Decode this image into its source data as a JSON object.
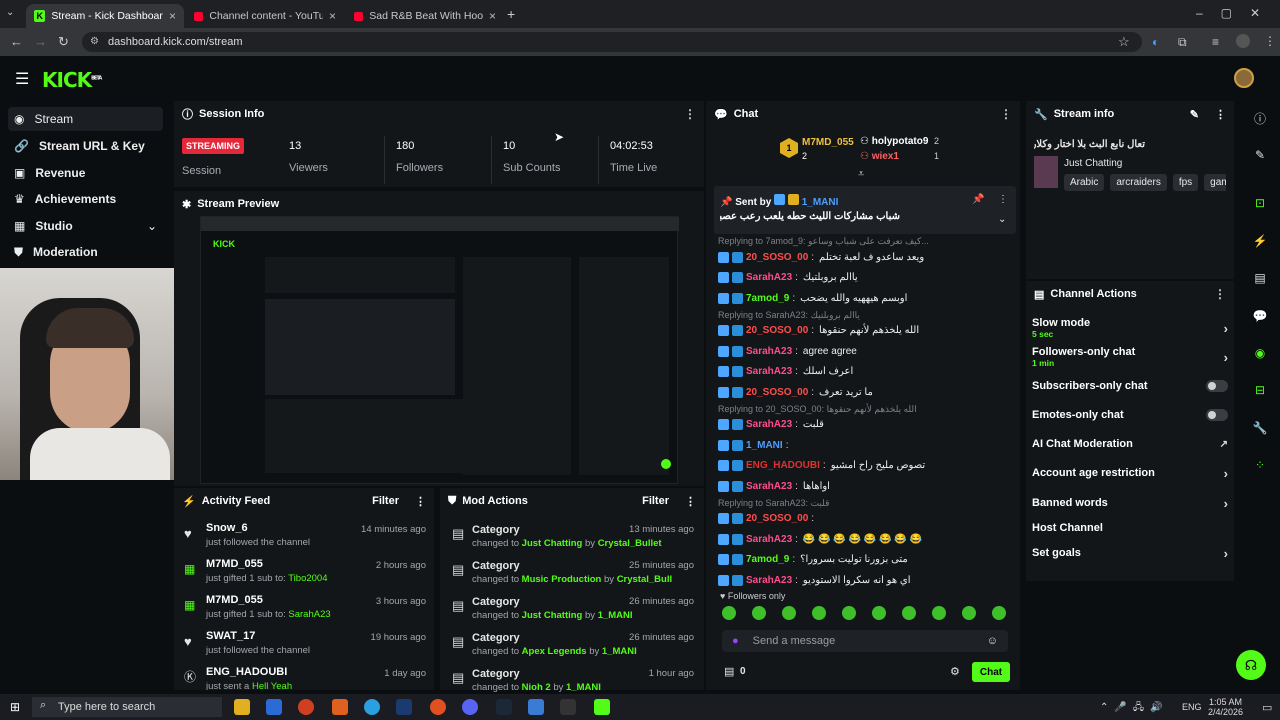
{
  "browser": {
    "tabs": [
      {
        "title": "Stream - Kick Dashboard"
      },
      {
        "title": "Channel content - YouTube Stu"
      },
      {
        "title": "Sad R&B Beat With Hook - Bea"
      }
    ],
    "url": "dashboard.kick.com/stream"
  },
  "brand": {
    "logo": "KICK",
    "beta": "BETA"
  },
  "sidebar": {
    "items": [
      {
        "label": "Stream",
        "icon": "broadcast-icon"
      },
      {
        "label": "Stream URL & Key",
        "icon": "link-icon"
      },
      {
        "label": "Revenue",
        "icon": "dollar-icon"
      },
      {
        "label": "Achievements",
        "icon": "trophy-icon"
      },
      {
        "label": "Studio",
        "icon": "studio-icon"
      },
      {
        "label": "Moderation",
        "icon": "shield-icon"
      }
    ]
  },
  "session": {
    "title": "Session Info",
    "status": "STREAMING",
    "status_label": "Session",
    "viewers": "13",
    "viewers_label": "Viewers",
    "followers": "180",
    "followers_label": "Followers",
    "subs": "10",
    "subs_label": "Sub Counts",
    "time": "04:02:53",
    "time_label": "Time Live"
  },
  "preview": {
    "title": "Stream Preview"
  },
  "activity": {
    "title": "Activity Feed",
    "filter": "Filter",
    "items": [
      {
        "name": "Snow_6",
        "text": "just followed the channel",
        "target": "",
        "time": "14 minutes ago"
      },
      {
        "name": "M7MD_055",
        "text": "just gifted 1 sub to: ",
        "target": "Tibo2004",
        "time": "2 hours ago"
      },
      {
        "name": "M7MD_055",
        "text": "just gifted 1 sub to: ",
        "target": "SarahA23",
        "time": "3 hours ago"
      },
      {
        "name": "SWAT_17",
        "text": "just followed the channel",
        "target": "",
        "time": "19 hours ago"
      },
      {
        "name": "ENG_HADOUBI",
        "text": "just sent a ",
        "target": "Hell Yeah",
        "time": "1 day ago"
      }
    ]
  },
  "mod": {
    "title": "Mod Actions",
    "filter": "Filter",
    "items": [
      {
        "name": "Category",
        "cat": "Just Chatting",
        "by": "Crystal_Bullet",
        "time": "13 minutes ago"
      },
      {
        "name": "Category",
        "cat": "Music Production",
        "by": "Crystal_Bullet",
        "time": "25 minutes ago"
      },
      {
        "name": "Category",
        "cat": "Just Chatting",
        "by": "1_MANI",
        "time": "26 minutes ago"
      },
      {
        "name": "Category",
        "cat": "Apex Legends",
        "by": "1_MANI",
        "time": "26 minutes ago"
      },
      {
        "name": "Category",
        "cat": "Nioh 2",
        "by": "1_MANI",
        "time": "1 hour ago"
      }
    ],
    "changed": "changed to",
    "by_word": "by"
  },
  "chat": {
    "title": "Chat",
    "top": [
      {
        "name": "M7MD_055",
        "count": "2"
      },
      {
        "name": "holypotato9",
        "count": "2"
      },
      {
        "name": "wiex1",
        "count": "1"
      }
    ],
    "pinned": {
      "label": "Sent by",
      "user": "1_MANI",
      "text": "شباب مشاركات الليث حطه يلعب رعب عصبياً علية"
    },
    "messages": [
      {
        "reply": "Replying to 7amod_9: كيف تعرفت على شباب وساعو..."
      },
      {
        "user": "20_SOSO_00",
        "color": "#ff4d4d",
        "text": "ويعد ساعدو ف لعبة تختلم"
      },
      {
        "user": "SarahA23",
        "color": "#ff4d8a",
        "text": "ياالم بروبلتيك"
      },
      {
        "user": "7amod_9",
        "color": "#53fc18",
        "text": "اوبسم هيههيه والله يضحب"
      },
      {
        "reply": "Replying to SarahA23: ياالم بروبلتيك"
      },
      {
        "user": "20_SOSO_00",
        "color": "#ff4d4d",
        "text": "الله يلخذهم لأنهم حنقوها"
      },
      {
        "user": "SarahA23",
        "color": "#ff4d8a",
        "text": "agree agree"
      },
      {
        "user": "SarahA23",
        "color": "#ff4d8a",
        "text": "اعرف اسلك"
      },
      {
        "user": "20_SOSO_00",
        "color": "#ff4d4d",
        "text": "ما تريد تعرف"
      },
      {
        "reply": "Replying to 20_SOSO_00: الله يلخذهم لأنهم حنقوها"
      },
      {
        "user": "SarahA23",
        "color": "#ff4d8a",
        "text": "قلبت"
      },
      {
        "user": "1_MANI",
        "color": "#4d9eff",
        "text": ""
      },
      {
        "user": "ENG_HADOUBI",
        "color": "#e03030",
        "text": "تصوص مليح راح امشيو"
      },
      {
        "user": "SarahA23",
        "color": "#ff4d8a",
        "text": "اواهاها"
      },
      {
        "reply": "Replying to SarahA23: قلبت"
      },
      {
        "user": "20_SOSO_00",
        "color": "#ff4d4d",
        "text": ""
      },
      {
        "user": "SarahA23",
        "color": "#ff4d8a",
        "text": "😂 😂 😂 😂 😂 😂 😂 😂"
      },
      {
        "user": "7amod_9",
        "color": "#53fc18",
        "text": "متى بزورنا توليت بسرورا؟"
      },
      {
        "user": "SarahA23",
        "color": "#ff4d8a",
        "text": "اي هو انه سكروا الاستوديو"
      }
    ],
    "followers_only": "Followers only",
    "placeholder": "Send a message",
    "count": "0",
    "send": "Chat"
  },
  "streaminfo": {
    "title": "Stream info",
    "stream_title": "تعال نابع البث بلا اختار وكلارات",
    "category": "Just Chatting",
    "tags": [
      "Arabic",
      "arcraiders",
      "fps",
      "gam"
    ]
  },
  "actions": {
    "title": "Channel Actions",
    "items": [
      {
        "label": "Slow mode",
        "sub": "5 sec",
        "kind": "chev"
      },
      {
        "label": "Followers-only chat",
        "sub": "1 min",
        "kind": "chev"
      },
      {
        "label": "Subscribers-only chat",
        "sub": "",
        "kind": "toggle"
      },
      {
        "label": "Emotes-only chat",
        "sub": "",
        "kind": "toggle"
      },
      {
        "label": "AI Chat Moderation",
        "sub": "",
        "kind": "ext"
      },
      {
        "label": "Account age restriction",
        "sub": "",
        "kind": "chev"
      },
      {
        "label": "Banned words",
        "sub": "",
        "kind": "chev"
      },
      {
        "label": "Host Channel",
        "sub": "",
        "kind": "none"
      },
      {
        "label": "Set goals",
        "sub": "",
        "kind": "chev"
      }
    ]
  },
  "taskbar": {
    "search": "Type here to search",
    "lang": "ENG",
    "time": "1:05 AM",
    "date": "2/4/2026"
  }
}
